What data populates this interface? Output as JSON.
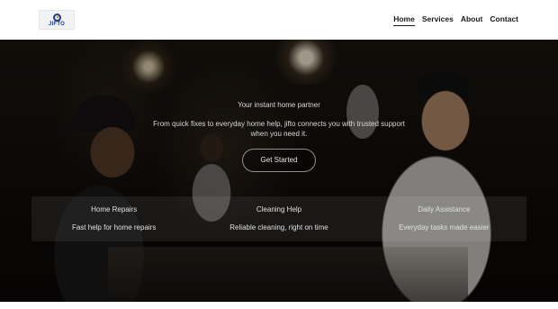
{
  "logo": {
    "text": "JIFTO",
    "alt": "jifto logo"
  },
  "nav": {
    "items": [
      {
        "label": "Home",
        "active": true
      },
      {
        "label": "Services",
        "active": false
      },
      {
        "label": "About",
        "active": false
      },
      {
        "label": "Contact",
        "active": false
      }
    ]
  },
  "hero": {
    "tagline": "Your instant home partner",
    "subtext": "From quick fixes to everyday home help, jifto connects you with trusted support when you need it.",
    "cta_label": "Get Started"
  },
  "services": [
    {
      "title": "Home Repairs",
      "description": "Fast help for home repairs"
    },
    {
      "title": "Cleaning Help",
      "description": "Reliable cleaning, right on time"
    },
    {
      "title": "Daily Assistance",
      "description": "Everyday tasks made easier"
    }
  ],
  "colors": {
    "header_bg": "#ffffff",
    "nav_text": "#1a1a1a",
    "hero_overlay": "rgba(0,0,0,0.38)",
    "hero_text": "#d8d8d8",
    "logo_blue": "#1e3b8c",
    "logo_orange": "#f28c28"
  }
}
